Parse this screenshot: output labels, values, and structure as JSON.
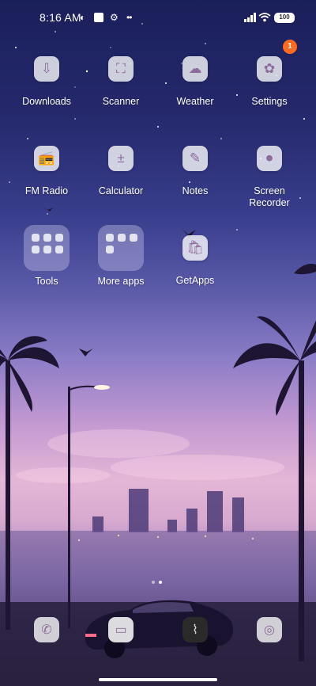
{
  "status_bar": {
    "time": "8:16 AM",
    "battery": "100"
  },
  "settings_badge": "1",
  "apps": [
    {
      "label": "Downloads"
    },
    {
      "label": "Scanner"
    },
    {
      "label": "Weather"
    },
    {
      "label": "Settings"
    },
    {
      "label": "FM Radio"
    },
    {
      "label": "Calculator"
    },
    {
      "label": "Notes"
    },
    {
      "label": "Screen Recorder"
    },
    {
      "label": "GetApps"
    }
  ],
  "folders": [
    {
      "label": "Tools"
    },
    {
      "label": "More apps"
    }
  ],
  "colors": {
    "tile": "#f2e8f4",
    "icon": "#8c6c9a",
    "badge": "#ff6a1f"
  }
}
